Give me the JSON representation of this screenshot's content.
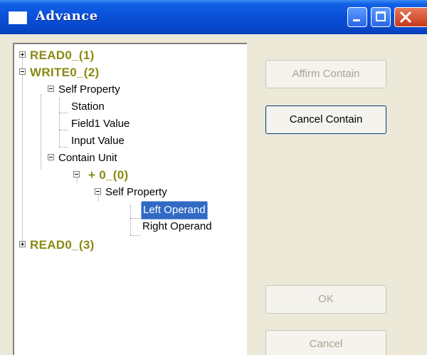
{
  "window": {
    "title": "Advance",
    "titlebar_color": "#0a4fd8",
    "close_color": "#c7381a"
  },
  "tree": {
    "selection_color": "#316ac5",
    "bold_color": "#8a8a14",
    "nodes": [
      {
        "label": "READ0_(1)",
        "expander": "plus",
        "bold": true
      },
      {
        "label": "WRITE0_(2)",
        "expander": "minus",
        "bold": true
      },
      {
        "label": "Self Property",
        "expander": "minus"
      },
      {
        "label": "Station"
      },
      {
        "label": "Field1 Value"
      },
      {
        "label": "Input Value"
      },
      {
        "label": "Contain Unit",
        "expander": "minus"
      },
      {
        "label": "+ 0_(0)",
        "expander": "minus",
        "bold": true
      },
      {
        "label": "Self Property",
        "expander": "minus"
      },
      {
        "label": "Left Operand",
        "selected": true
      },
      {
        "label": "Right Operand"
      },
      {
        "label": "READ0_(3)",
        "expander": "plus",
        "bold": true
      }
    ]
  },
  "buttons": {
    "affirm_contain": {
      "label": "Affirm Contain",
      "enabled": false
    },
    "cancel_contain": {
      "label": "Cancel Contain",
      "enabled": true
    },
    "ok": {
      "label": "OK",
      "enabled": false
    },
    "cancel": {
      "label": "Cancel",
      "enabled": false
    }
  }
}
